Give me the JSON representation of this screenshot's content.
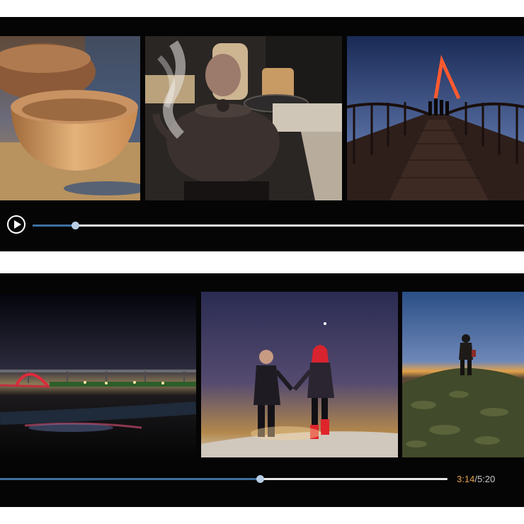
{
  "player_top": {
    "progress": 0.086,
    "thumbnails": [
      "clay-bowls",
      "iron-teapot-steam",
      "bridge-silhouettes"
    ],
    "play_icon": "play-icon"
  },
  "player_bottom": {
    "progress": 0.58,
    "current_time": "3:14",
    "separator": "/",
    "total_time": "5:20",
    "thumbnails": [
      "night-harbor-bridge",
      "couple-holding-hands",
      "man-on-rocks-dusk"
    ]
  },
  "colors": {
    "progress_fill": "#3d6f9f",
    "track": "#e8e8e8",
    "knob": "#b8cee6",
    "current_time": "#e2a04e",
    "background": "#050505"
  }
}
